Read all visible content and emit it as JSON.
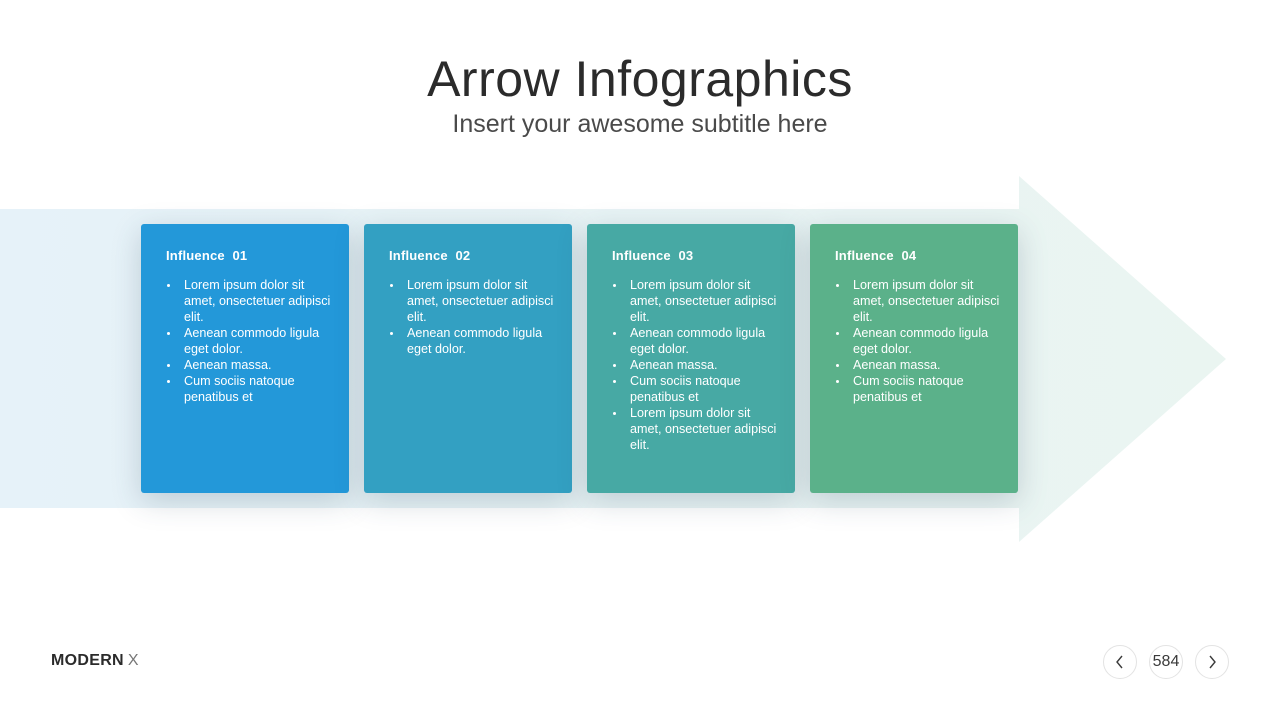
{
  "header": {
    "title": "Arrow Infographics",
    "subtitle": "Insert your awesome subtitle here"
  },
  "colors": {
    "arrow_left": "#e6f2f9",
    "arrow_right": "#eaf5f1",
    "card_1": "#2398d9",
    "card_2": "#33a0c2",
    "card_3": "#47a9a4",
    "card_4": "#5bb18a"
  },
  "cards": [
    {
      "title": "Influence  01",
      "bullets": [
        "Lorem ipsum dolor sit amet, onsectetuer adipisci elit.",
        "Aenean commodo ligula eget dolor.",
        "Aenean massa.",
        "Cum sociis natoque penatibus et"
      ]
    },
    {
      "title": "Influence  02",
      "bullets": [
        "Lorem ipsum dolor sit amet, onsectetuer adipisci elit.",
        "Aenean commodo ligula eget dolor."
      ]
    },
    {
      "title": "Influence  03",
      "bullets": [
        "Lorem ipsum dolor sit amet, onsectetuer adipisci elit.",
        "Aenean commodo ligula eget dolor.",
        "Aenean massa.",
        "Cum sociis natoque penatibus et",
        "Lorem ipsum dolor sit amet, onsectetuer adipisci elit."
      ]
    },
    {
      "title": "Influence  04",
      "bullets": [
        "Lorem ipsum dolor sit amet, onsectetuer adipisci elit.",
        "Aenean commodo ligula eget dolor.",
        "Aenean massa.",
        "Cum sociis natoque penatibus et"
      ]
    }
  ],
  "footer": {
    "brand_bold": "MODERN",
    "brand_light": "X",
    "page_number": "584",
    "prev_icon": "chevron-left-icon",
    "next_icon": "chevron-right-icon"
  }
}
